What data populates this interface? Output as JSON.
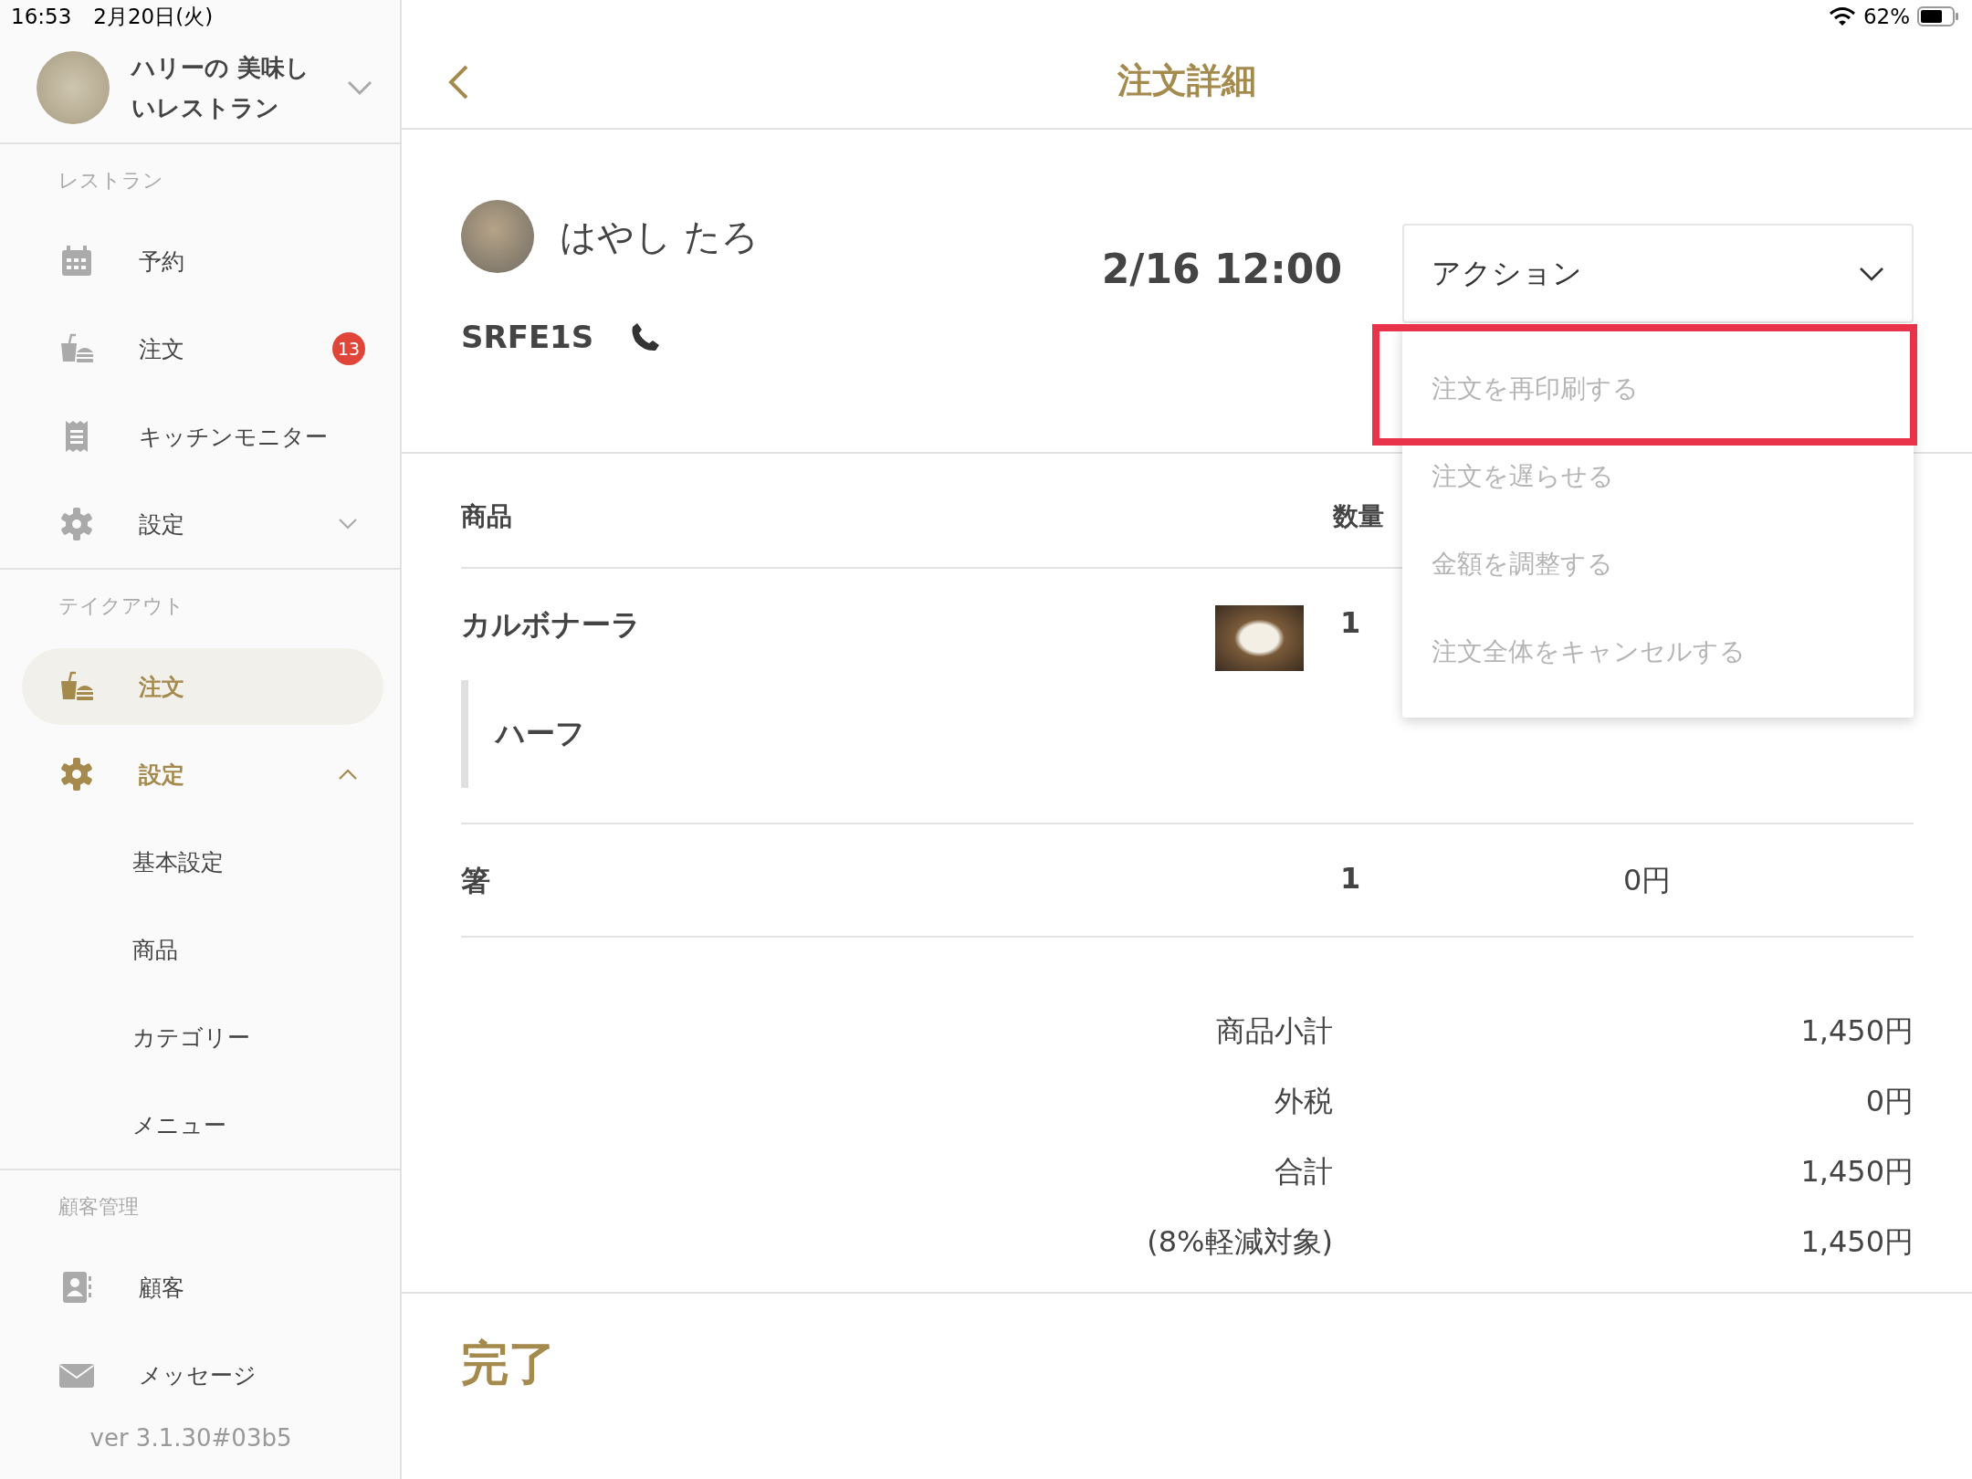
{
  "status_bar": {
    "time": "16:53",
    "date": "2月20日(火)",
    "battery": "62%"
  },
  "sidebar": {
    "store_name": "ハリーの 美味しいレストラン",
    "sections": [
      {
        "title": "レストラン",
        "items": [
          {
            "label": "予約",
            "kind": "calendar",
            "selected": false
          },
          {
            "label": "注文",
            "kind": "food",
            "selected": false,
            "badge": "13"
          },
          {
            "label": "キッチンモニター",
            "kind": "receipt",
            "selected": false
          },
          {
            "label": "設定",
            "kind": "gear",
            "selected": false,
            "expanded": false
          }
        ]
      },
      {
        "title": "テイクアウト",
        "items": [
          {
            "label": "注文",
            "kind": "food",
            "selected": true
          },
          {
            "label": "設定",
            "kind": "gear",
            "selected": false,
            "expanded": true,
            "children": [
              {
                "label": "基本設定"
              },
              {
                "label": "商品"
              },
              {
                "label": "カテゴリー"
              },
              {
                "label": "メニュー"
              }
            ]
          }
        ]
      },
      {
        "title": "顧客管理",
        "items": [
          {
            "label": "顧客",
            "kind": "contact",
            "selected": false
          },
          {
            "label": "メッセージ",
            "kind": "mail",
            "selected": false
          }
        ]
      }
    ],
    "version": "ver 3.1.30#03b5"
  },
  "header": {
    "title": "注文詳細"
  },
  "order": {
    "customer_name": "はやし たろ",
    "code": "SRFE1S",
    "datetime": "2/16 12:00",
    "action": {
      "label": "アクション",
      "menu": [
        {
          "label": "注文を再印刷する",
          "highlighted": true
        },
        {
          "label": "注文を遅らせる",
          "highlighted": false
        },
        {
          "label": "金額を調整する",
          "highlighted": false
        },
        {
          "label": "注文全体をキャンセルする",
          "highlighted": false
        }
      ]
    }
  },
  "table": {
    "columns": [
      "商品",
      "数量"
    ],
    "rows": [
      {
        "name": "カルボナーラ",
        "qty": "1",
        "photo": true,
        "options": [
          "ハーフ"
        ]
      },
      {
        "name": "箸",
        "qty": "1",
        "price": "0円",
        "photo": false
      }
    ]
  },
  "totals": [
    {
      "label": "商品小計",
      "value": "1,450円"
    },
    {
      "label": "外税",
      "value": "0円"
    },
    {
      "label": "合計",
      "value": "1,450円"
    },
    {
      "label": "(8%軽減対象)",
      "value": "1,450円"
    }
  ],
  "status": "完了"
}
